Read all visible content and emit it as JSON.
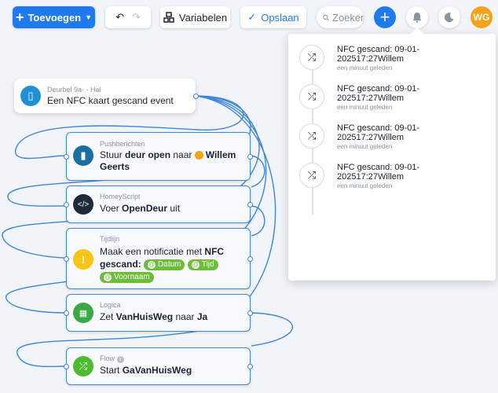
{
  "toolbar": {
    "add_label": "Toevoegen",
    "variables_label": "Variabelen",
    "save_label": "Opslaan",
    "search_placeholder": "Zoeken",
    "avatar_initials": "WG"
  },
  "trigger": {
    "category": "Deurbel 9a- - Hal",
    "text": "Een NFC kaart gescand event"
  },
  "actions": [
    {
      "category": "Pushberichten",
      "text_a": "Stuur ",
      "bold_a": "deur open",
      "text_b": " naar ",
      "bold_b": "Willem Geerts"
    },
    {
      "category": "HomeyScript",
      "text_a": "Voer ",
      "bold_a": "OpenDeur",
      "text_b": " uit"
    },
    {
      "category": "Tijdlijn",
      "text_a": "Maak een notificatie met ",
      "bold_a": "NFC gescand:",
      "chips": [
        "Datum",
        "Tijd",
        "Voornaam"
      ]
    },
    {
      "category": "Logica",
      "text_a": "Zet ",
      "bold_a": "VanHuisWeg",
      "text_b": " naar ",
      "bold_b": "Ja"
    },
    {
      "category": "Flow",
      "text_a": "Start ",
      "bold_a": "GaVanHuisWeg"
    }
  ],
  "notifications": [
    {
      "text": "NFC gescand: 09-01-202517:27Willem",
      "time": "een minuut geleden"
    },
    {
      "text": "NFC gescand: 09-01-202517:27Willem",
      "time": "een minuut geleden"
    },
    {
      "text": "NFC gescand: 09-01-202517:27Willem",
      "time": "een minuut geleden"
    },
    {
      "text": "NFC gescand: 09-01-202517:27Willem",
      "time": "een minuut geleden"
    }
  ],
  "colors": {
    "accent": "#1f7af0",
    "wire": "#3f86d6",
    "push": "#1d6ea0",
    "script": "#1e2a3a",
    "timeline": "#f5c518",
    "logic": "#3aa845",
    "flow": "#4cbb2e",
    "chip": "#6ebd3a",
    "avatar": "#f5a21b"
  },
  "icons": {
    "add": "plus-icon",
    "undo": "undo-icon",
    "redo": "redo-icon",
    "variables": "variables-icon",
    "save": "check-icon",
    "search": "search-icon",
    "new": "plus-icon",
    "notifications": "bell-icon",
    "theme": "moon-icon",
    "notification_item": "shuffle-icon"
  }
}
